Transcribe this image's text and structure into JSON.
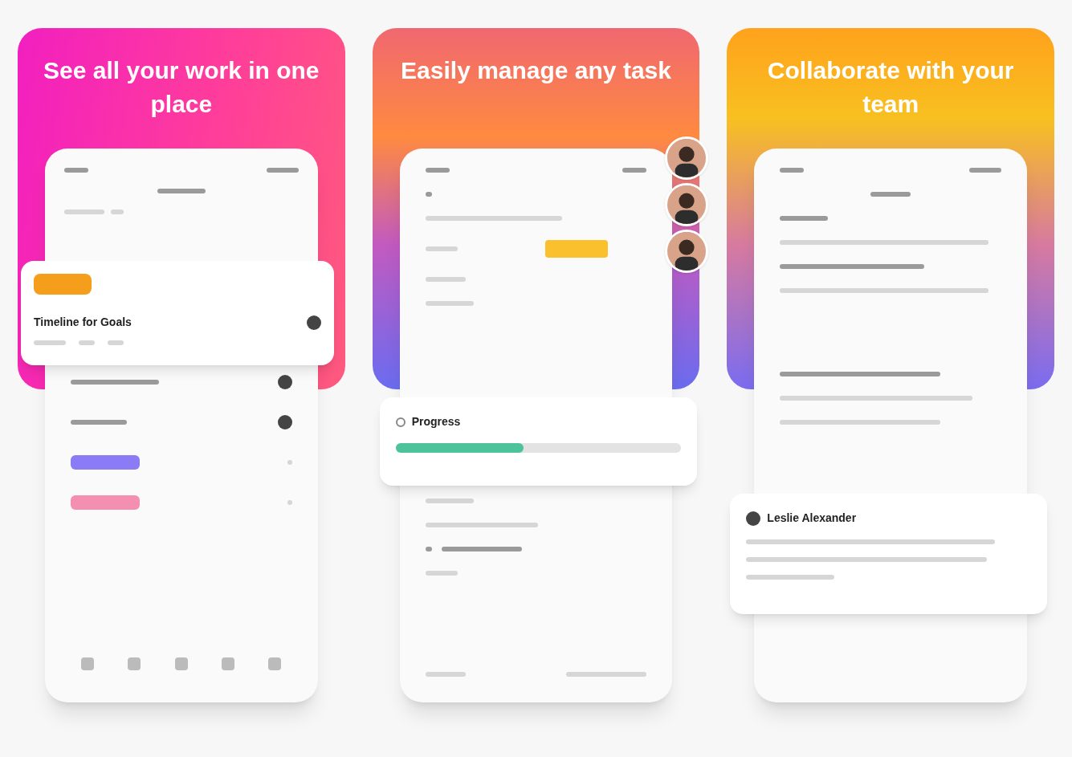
{
  "panels": [
    {
      "kind": "overview",
      "title": "See all your work in one place",
      "overlay": {
        "title": "Timeline for Goals"
      },
      "timeline_bars": [
        {
          "color": "#8b7cf6"
        },
        {
          "color": "#f48fb1"
        }
      ]
    },
    {
      "kind": "task",
      "title": "Easily manage any task",
      "progress": {
        "label": "Progress",
        "level": 0.45
      }
    },
    {
      "kind": "chat",
      "title": "Collaborate with your team",
      "comment": {
        "author": "Leslie Alexander"
      }
    }
  ]
}
